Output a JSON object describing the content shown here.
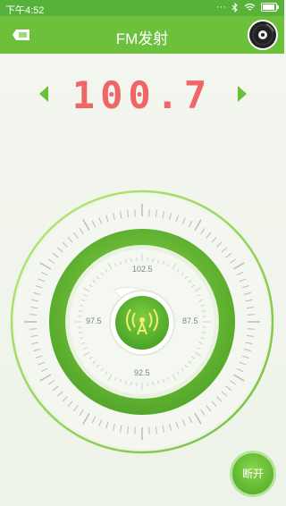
{
  "status": {
    "time": "下午4:52"
  },
  "header": {
    "title": "FM发射"
  },
  "frequency": {
    "value": "100.7"
  },
  "dial": {
    "labels": {
      "top": "102.5",
      "left": "97.5",
      "right": "87.5",
      "bottom": "92.5"
    }
  },
  "actions": {
    "disconnect": "断开"
  },
  "colors": {
    "accent": "#6cc03c",
    "frequency": "#f06565"
  }
}
